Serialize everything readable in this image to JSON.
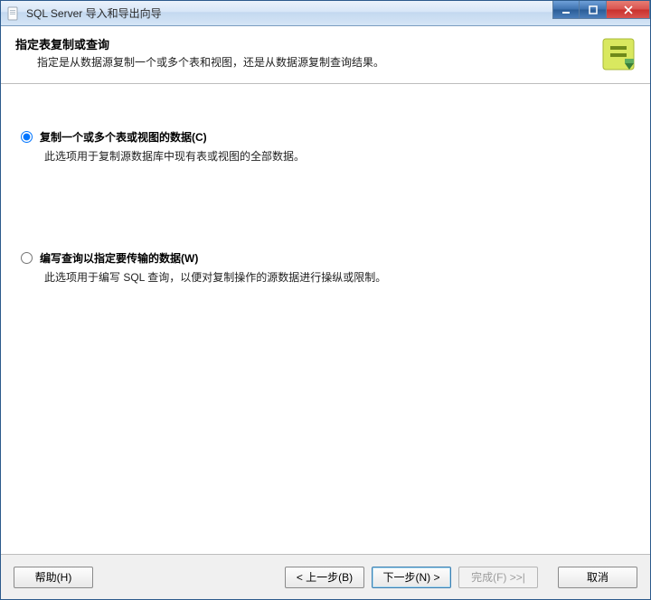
{
  "titlebar": {
    "title": "SQL Server 导入和导出向导"
  },
  "header": {
    "title": "指定表复制或查询",
    "desc": "指定是从数据源复制一个或多个表和视图，还是从数据源复制查询结果。"
  },
  "options": {
    "copy": {
      "label": "复制一个或多个表或视图的数据(C)",
      "desc": "此选项用于复制源数据库中现有表或视图的全部数据。",
      "selected": true
    },
    "query": {
      "label": "编写查询以指定要传输的数据(W)",
      "desc": "此选项用于编写 SQL 查询，以便对复制操作的源数据进行操纵或限制。",
      "selected": false
    }
  },
  "buttons": {
    "help": "帮助(H)",
    "back": "< 上一步(B)",
    "next": "下一步(N) >",
    "finish": "完成(F) >>|",
    "cancel": "取消"
  }
}
